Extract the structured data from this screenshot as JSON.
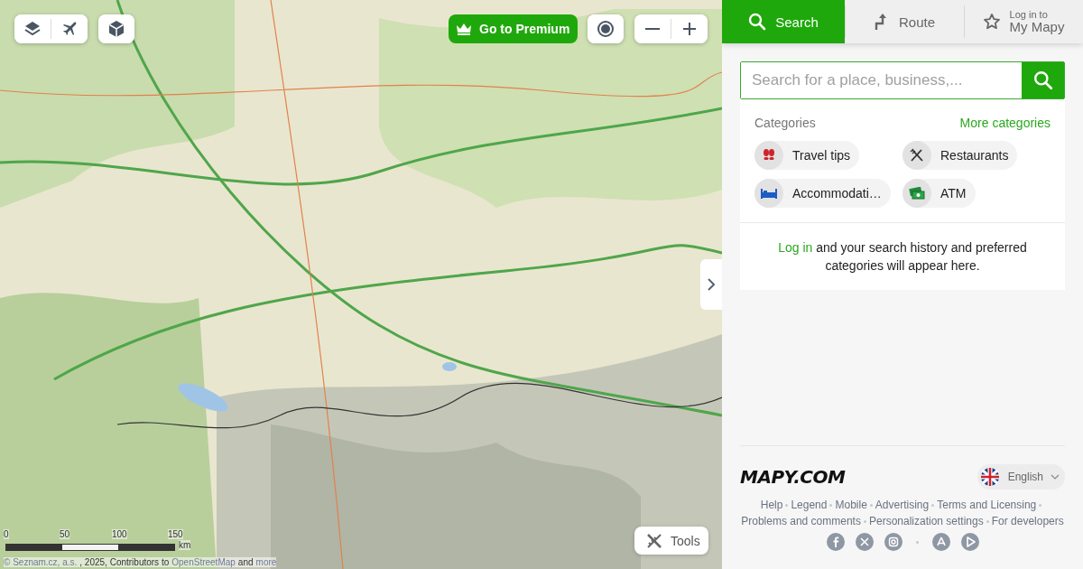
{
  "map_toolbar": {
    "premium": "Go to Premium"
  },
  "scale": {
    "ticks": [
      "0",
      "50",
      "100",
      "150"
    ],
    "unit": "km"
  },
  "attribution": [
    {
      "kind": "link",
      "text": "© Seznam.cz, a.s."
    },
    {
      "kind": "text",
      "text": ", 2025, Contributors to"
    },
    {
      "kind": "link",
      "text": "OpenStreetMap"
    },
    {
      "kind": "text",
      "text": "and"
    },
    {
      "kind": "link",
      "text": "more"
    }
  ],
  "tools_button": "Tools",
  "tabs": [
    {
      "kind": "search",
      "label": "Search",
      "selected": true
    },
    {
      "kind": "route",
      "label": "Route",
      "selected": false
    },
    {
      "kind": "favorites",
      "sublabel": "Log in to",
      "label": "My Mapy",
      "selected": false
    }
  ],
  "search": {
    "placeholder": "Search for a place, business,..."
  },
  "categories": {
    "title": "Categories",
    "more": "More categories",
    "items": [
      {
        "kind": "tips",
        "label": "Travel tips"
      },
      {
        "kind": "food",
        "label": "Restaurants"
      },
      {
        "kind": "bed",
        "label": "Accommodati…"
      },
      {
        "kind": "atm",
        "label": "ATM"
      }
    ]
  },
  "login_note": [
    {
      "kind": "link",
      "text": "Log in"
    },
    {
      "kind": "text",
      "text": " and your search history and preferred categories will appear here."
    }
  ],
  "footer": {
    "logo": "MAPY.COM",
    "language": "English",
    "links": [
      "Help",
      "Legend",
      "Mobile",
      "Advertising",
      "Terms and Licensing",
      "Problems and comments",
      "Personalization settings",
      "For developers"
    ],
    "social": [
      {
        "kind": "facebook"
      },
      {
        "kind": "x"
      },
      {
        "kind": "instagram"
      },
      {
        "kind": "appstore"
      },
      {
        "kind": "playstore"
      }
    ]
  }
}
